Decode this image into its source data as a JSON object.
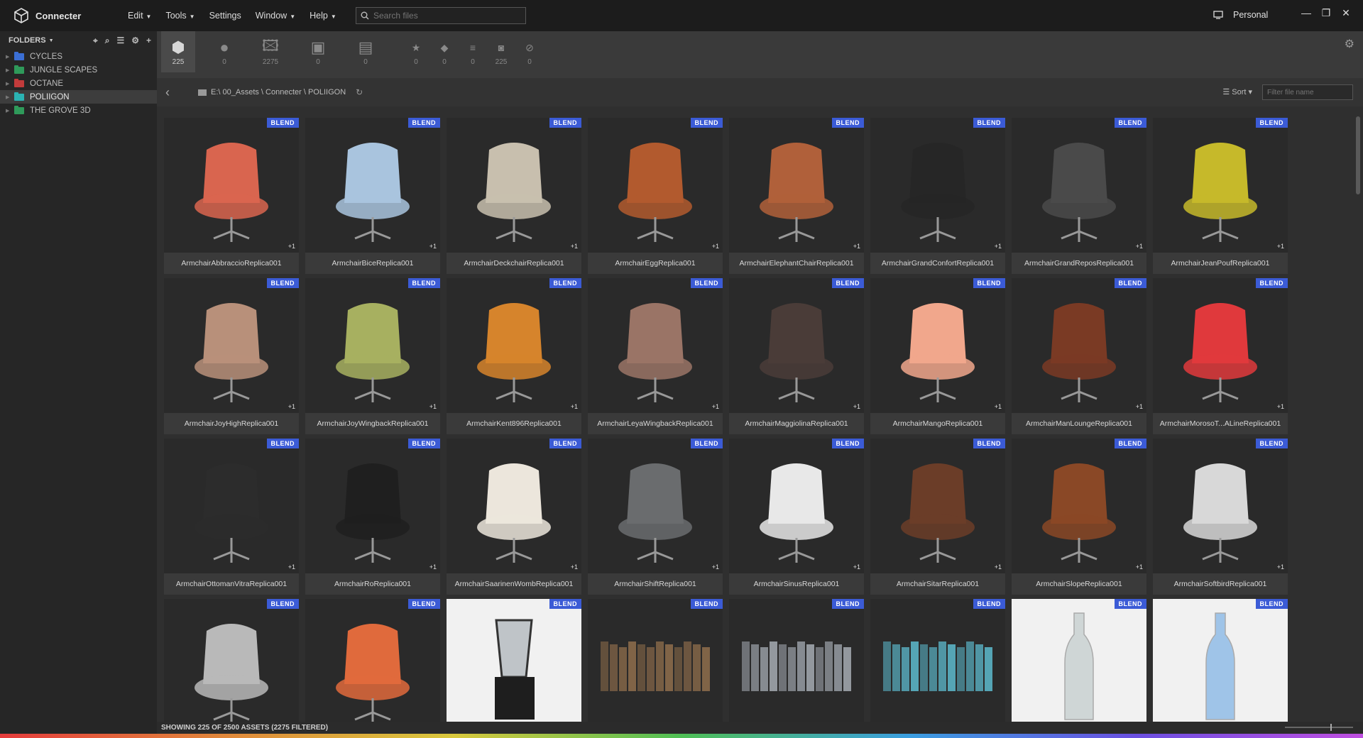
{
  "app": {
    "title": "Connecter"
  },
  "menu": [
    {
      "label": "Edit",
      "dropdown": true
    },
    {
      "label": "Tools",
      "dropdown": true
    },
    {
      "label": "Settings",
      "dropdown": false
    },
    {
      "label": "Window",
      "dropdown": true
    },
    {
      "label": "Help",
      "dropdown": true
    }
  ],
  "search": {
    "placeholder": "Search files"
  },
  "account": {
    "label": "Personal"
  },
  "sidebar": {
    "header": "FOLDERS",
    "folders": [
      {
        "label": "CYCLES",
        "color": "#3b6fd4"
      },
      {
        "label": "JUNGLE SCAPES",
        "color": "#2f9a5a"
      },
      {
        "label": "OCTANE",
        "color": "#c23b3b"
      },
      {
        "label": "POLIIGON",
        "color": "#2bb3b3"
      },
      {
        "label": "THE GROVE 3D",
        "color": "#2f9a5a"
      }
    ],
    "active_index": 3
  },
  "types": [
    {
      "icon": "cube-icon",
      "count": "225"
    },
    {
      "icon": "sphere-icon",
      "count": "0"
    },
    {
      "icon": "image-icon",
      "count": "2275"
    },
    {
      "icon": "video-icon",
      "count": "0"
    },
    {
      "icon": "document-icon",
      "count": "0"
    },
    {
      "icon": "star-icon",
      "count": "0"
    },
    {
      "icon": "tag-icon",
      "count": "0"
    },
    {
      "icon": "list-icon",
      "count": "0"
    },
    {
      "icon": "camera-icon",
      "count": "225"
    },
    {
      "icon": "block-icon",
      "count": "0"
    }
  ],
  "path": {
    "text": "E:\\ 00_Assets \\ Connecter \\ POLIIGON"
  },
  "toolbar": {
    "sort_label": "Sort",
    "filter_placeholder": "Filter file name"
  },
  "assets": [
    {
      "name": "ArmchairAbbraccioReplica001",
      "badge": "BLEND",
      "plus": "+1",
      "color": "#d9654f"
    },
    {
      "name": "ArmchairBiceReplica001",
      "badge": "BLEND",
      "plus": "+1",
      "color": "#a9c4de"
    },
    {
      "name": "ArmchairDeckchairReplica001",
      "badge": "BLEND",
      "plus": "+1",
      "color": "#c8bfae"
    },
    {
      "name": "ArmchairEggReplica001",
      "badge": "BLEND",
      "plus": "+1",
      "color": "#b25a2e"
    },
    {
      "name": "ArmchairElephantChairReplica001",
      "badge": "BLEND",
      "plus": "+1",
      "color": "#b0603a"
    },
    {
      "name": "ArmchairGrandConfortReplica001",
      "badge": "BLEND",
      "plus": "+1",
      "color": "#262626"
    },
    {
      "name": "ArmchairGrandReposReplica001",
      "badge": "BLEND",
      "plus": "+1",
      "color": "#4a4a4a"
    },
    {
      "name": "ArmchairJeanPoufReplica001",
      "badge": "BLEND",
      "plus": "+1",
      "color": "#c6b92a"
    },
    {
      "name": "ArmchairJoyHighReplica001",
      "badge": "BLEND",
      "plus": "+1",
      "color": "#b8907a"
    },
    {
      "name": "ArmchairJoyWingbackReplica001",
      "badge": "BLEND",
      "plus": "+1",
      "color": "#a7b060"
    },
    {
      "name": "ArmchairKent896Replica001",
      "badge": "BLEND",
      "plus": "+1",
      "color": "#d6842c"
    },
    {
      "name": "ArmchairLeyaWingbackReplica001",
      "badge": "BLEND",
      "plus": "+1",
      "color": "#9a7466"
    },
    {
      "name": "ArmchairMaggiolinaReplica001",
      "badge": "BLEND",
      "plus": "+1",
      "color": "#4a3c38"
    },
    {
      "name": "ArmchairMangoReplica001",
      "badge": "BLEND",
      "plus": "+1",
      "color": "#f1a78c"
    },
    {
      "name": "ArmchairManLoungeReplica001",
      "badge": "BLEND",
      "plus": "+1",
      "color": "#7a3a24"
    },
    {
      "name": "ArmchairMorosoT...ALineReplica001",
      "badge": "BLEND",
      "plus": "+1",
      "color": "#e0393c"
    },
    {
      "name": "ArmchairOttomanVitraReplica001",
      "badge": "BLEND",
      "plus": "+1",
      "color": "#2c2c2c"
    },
    {
      "name": "ArmchairRoReplica001",
      "badge": "BLEND",
      "plus": "+1",
      "color": "#1f1f1f"
    },
    {
      "name": "ArmchairSaarinenWombReplica001",
      "badge": "BLEND",
      "plus": "+1",
      "color": "#ece6dc"
    },
    {
      "name": "ArmchairShiftReplica001",
      "badge": "BLEND",
      "plus": "+1",
      "color": "#6a6c6e"
    },
    {
      "name": "ArmchairSinusReplica001",
      "badge": "BLEND",
      "plus": "+1",
      "color": "#e8e8e8"
    },
    {
      "name": "ArmchairSitarReplica001",
      "badge": "BLEND",
      "plus": "+1",
      "color": "#6b3d28"
    },
    {
      "name": "ArmchairSlopeReplica001",
      "badge": "BLEND",
      "plus": "+1",
      "color": "#8a4826"
    },
    {
      "name": "ArmchairSoftbirdReplica001",
      "badge": "BLEND",
      "plus": "+1",
      "color": "#d8d8d8"
    },
    {
      "name": "",
      "badge": "BLEND",
      "plus": "",
      "color": "#b9b9b9"
    },
    {
      "name": "",
      "badge": "BLEND",
      "plus": "",
      "color": "#e06a3c"
    },
    {
      "name": "",
      "badge": "BLEND",
      "plus": "",
      "color": "#1e1e1e"
    },
    {
      "name": "",
      "badge": "BLEND",
      "plus": "",
      "color": "#8a6a4a"
    },
    {
      "name": "",
      "badge": "BLEND",
      "plus": "",
      "color": "#9ea4ab"
    },
    {
      "name": "",
      "badge": "BLEND",
      "plus": "",
      "color": "#5ab2c4"
    },
    {
      "name": "",
      "badge": "BLEND",
      "plus": "",
      "color": "#cfd6d6"
    },
    {
      "name": "",
      "badge": "BLEND",
      "plus": "",
      "color": "#9fc4e8"
    }
  ],
  "status": {
    "text": "SHOWING 225 OF 2500 ASSETS (2275 FILTERED)"
  }
}
